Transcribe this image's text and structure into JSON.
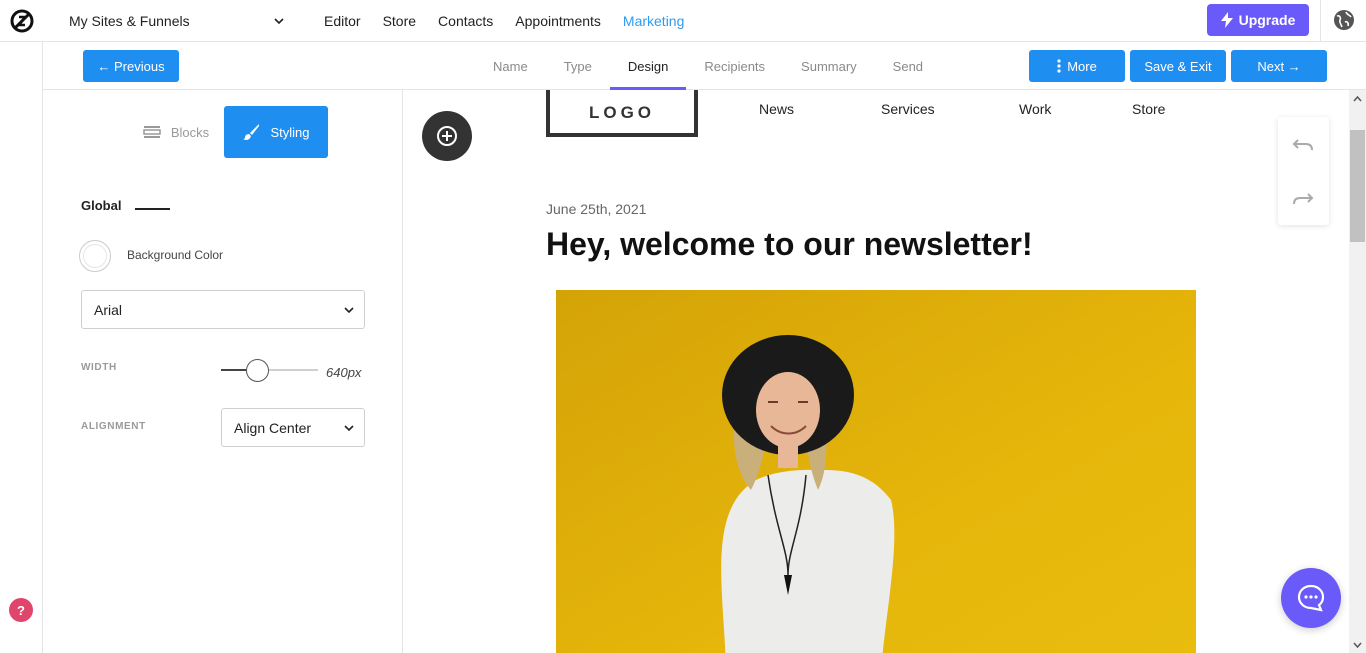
{
  "topbar": {
    "site_selector": "My Sites & Funnels",
    "nav": [
      "Editor",
      "Store",
      "Contacts",
      "Appointments",
      "Marketing"
    ],
    "active_nav": "Marketing",
    "upgrade_label": "Upgrade"
  },
  "stepbar": {
    "previous_label": "← Previous",
    "steps": [
      "Name",
      "Type",
      "Design",
      "Recipients",
      "Summary",
      "Send"
    ],
    "active_step": "Design",
    "more_label": "More",
    "save_label": "Save & Exit",
    "next_label": "Next →"
  },
  "panel": {
    "tab_blocks": "Blocks",
    "tab_styling": "Styling",
    "global_label": "Global",
    "background_color_label": "Background Color",
    "font_value": "Arial",
    "width_label": "WIDTH",
    "width_value": "640px",
    "alignment_label": "ALIGNMENT",
    "alignment_value": "Align Center"
  },
  "email": {
    "logo_text": "LOGO",
    "nav": [
      "News",
      "Services",
      "Work",
      "Store"
    ],
    "date": "June 25th, 2021",
    "headline": "Hey, welcome to our newsletter!"
  },
  "help_label": "?",
  "colors": {
    "accent": "#1f8ef1",
    "upgrade": "#6a5af9",
    "active_link": "#2f9bf0",
    "hero_bg": "#e2b40a"
  }
}
